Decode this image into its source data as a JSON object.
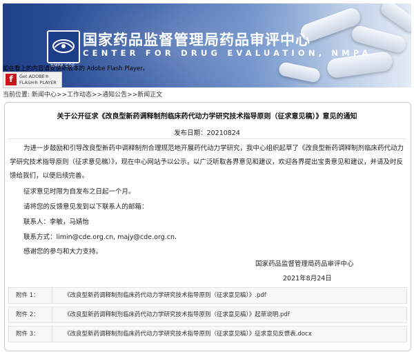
{
  "header": {
    "title_cn": "国家药品监督管理局药品审评中心",
    "title_en": "CENTER FOR DRUG EVALUATION, NMPA",
    "logo_caption": "NMPA CDE",
    "logo_icon": "cde-logo-icon"
  },
  "flash": {
    "message": "如在看上的内容请安装新版本的 Adobe Flash Player。",
    "badge_line1": "Get ADOBE®",
    "badge_line2": "FLASH® PLAYER",
    "badge_letter": "f"
  },
  "breadcrumb": {
    "prefix": "当前位置:",
    "items": [
      "新闻中心",
      "工作动态",
      "通知公告",
      "新闻正文"
    ],
    "separator": ">>"
  },
  "article": {
    "title": "关于公开征求《改良型新药调释制剂临床药代动力学研究技术指导原则（征求意见稿）》意见的通知",
    "publish_date": "发布日期：20210824",
    "paragraph1": "为进一步鼓励和引导改良型新药中调释制剂合理规范地开展药代动力学研究，我中心组织起草了《改良型新药调释制剂临床药代动力学研究技术指导原则（征求意见稿）》，现在中心网站予以公示，以广泛听取各界意见和建议，欢迎各界提出宝贵意见和建议，并请及时反馈给我们，以便后续完善。",
    "line_period": "征求意见时限为自发布之日起一个月。",
    "line_feedback": "请将您的反馈意见发到以下联系人的邮箱：",
    "line_contacts": "联系人：李敏，马婧怡",
    "line_email": "联系方式：limin@cde.org.cn, majy@cde.org.cn.",
    "line_thanks": "感谢您的参与和大力支持。",
    "signature_org": "国家药品监督管理局药品审评中心",
    "signature_date": "2021年8月24日"
  },
  "attachments": [
    {
      "label": "附件 1：",
      "name": "《改良型新药调释制剂临床药代动力学研究技术指导原则（征求意见稿）》.pdf"
    },
    {
      "label": "附件 2：",
      "name": "《改良型新药调释制剂临床药代动力学研究技术指导原则（征求意见稿）》起草说明.pdf"
    },
    {
      "label": "附件 3：",
      "name": "《改良型新药调释制剂临床药代动力学研究技术指导原则（征求意见稿）》征求意见反馈表.docx"
    }
  ],
  "colors": {
    "banner_dark": "#1f3f86",
    "banner_light": "#e3ecf6",
    "flash_red": "#c8171d"
  }
}
